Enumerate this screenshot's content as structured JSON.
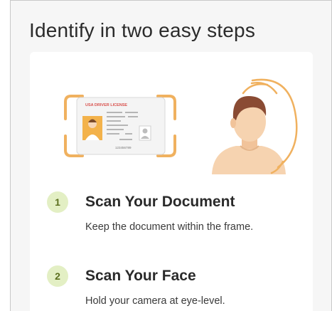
{
  "heading": "Identify in two easy steps",
  "illustration": {
    "card_header": "USA DRIVER LICENSE",
    "card_number": "123456789"
  },
  "steps": [
    {
      "number": "1",
      "title": "Scan Your Document",
      "description": "Keep the document within the frame."
    },
    {
      "number": "2",
      "title": "Scan Your Face",
      "description": "Hold your camera at eye-level."
    }
  ],
  "colors": {
    "accent_orange": "#f0b15f",
    "badge_bg": "#e3efc4",
    "badge_text": "#5b6f1e"
  }
}
